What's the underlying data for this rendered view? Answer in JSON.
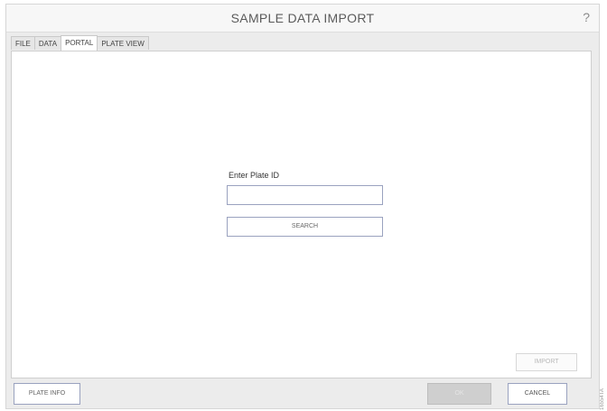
{
  "window": {
    "title": "SAMPLE DATA IMPORT",
    "help_label": "?"
  },
  "tabs": [
    {
      "label": "FILE",
      "active": false
    },
    {
      "label": "DATA",
      "active": false
    },
    {
      "label": "PORTAL",
      "active": true
    },
    {
      "label": "PLATE VIEW",
      "active": false
    }
  ],
  "portal": {
    "plate_id_label": "Enter Plate ID",
    "plate_id_value": "",
    "plate_id_placeholder": "",
    "search_label": "SEARCH",
    "import_label": "IMPORT",
    "import_enabled": false
  },
  "footer": {
    "plate_info_label": "PLATE INFO",
    "ok_label": "OK",
    "ok_enabled": false,
    "cancel_label": "CANCEL"
  },
  "figure_id": "16554TA"
}
